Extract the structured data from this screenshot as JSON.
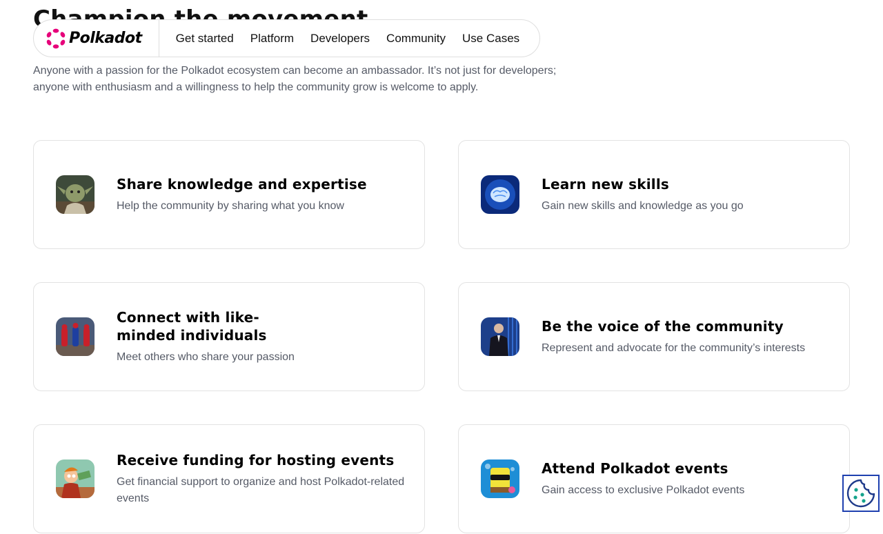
{
  "hero": {
    "title": "Champion the movement",
    "description": "Anyone with a passion for the Polkadot ecosystem can become an ambassador. It’s not just for developers; anyone with enthusiasm and a willingness to help the community grow is welcome to apply."
  },
  "navbar": {
    "logo_text": "Polkadot",
    "items": [
      {
        "label": "Get started"
      },
      {
        "label": "Platform"
      },
      {
        "label": "Developers"
      },
      {
        "label": "Community"
      },
      {
        "label": "Use Cases"
      }
    ]
  },
  "cards": [
    {
      "title": "Share knowledge and expertise",
      "description": "Help the community by sharing what you know",
      "icon": "yoda-avatar-icon"
    },
    {
      "title": "Learn new skills",
      "description": "Gain new skills and knowledge as you go",
      "icon": "glowing-brain-icon"
    },
    {
      "title": "Connect with like-\nminded individuals",
      "description": "Meet others who share your passion",
      "icon": "spiderman-pointing-icon"
    },
    {
      "title": "Be the voice of the community",
      "description": "Represent and advocate for the community’s interests",
      "icon": "businessman-icon"
    },
    {
      "title": "Receive funding for hosting events",
      "description": "Get financial support to organize and host Polkadot-related events",
      "icon": "fry-money-icon"
    },
    {
      "title": "Attend Polkadot events",
      "description": "Gain access to exclusive Polkadot events",
      "icon": "spongebob-sunglasses-icon"
    }
  ],
  "colors": {
    "brand_pink": "#E6007A",
    "text_muted": "#555a66",
    "cookie_border": "#1e40af"
  },
  "cookie_button": {
    "icon": "cookie-icon"
  }
}
